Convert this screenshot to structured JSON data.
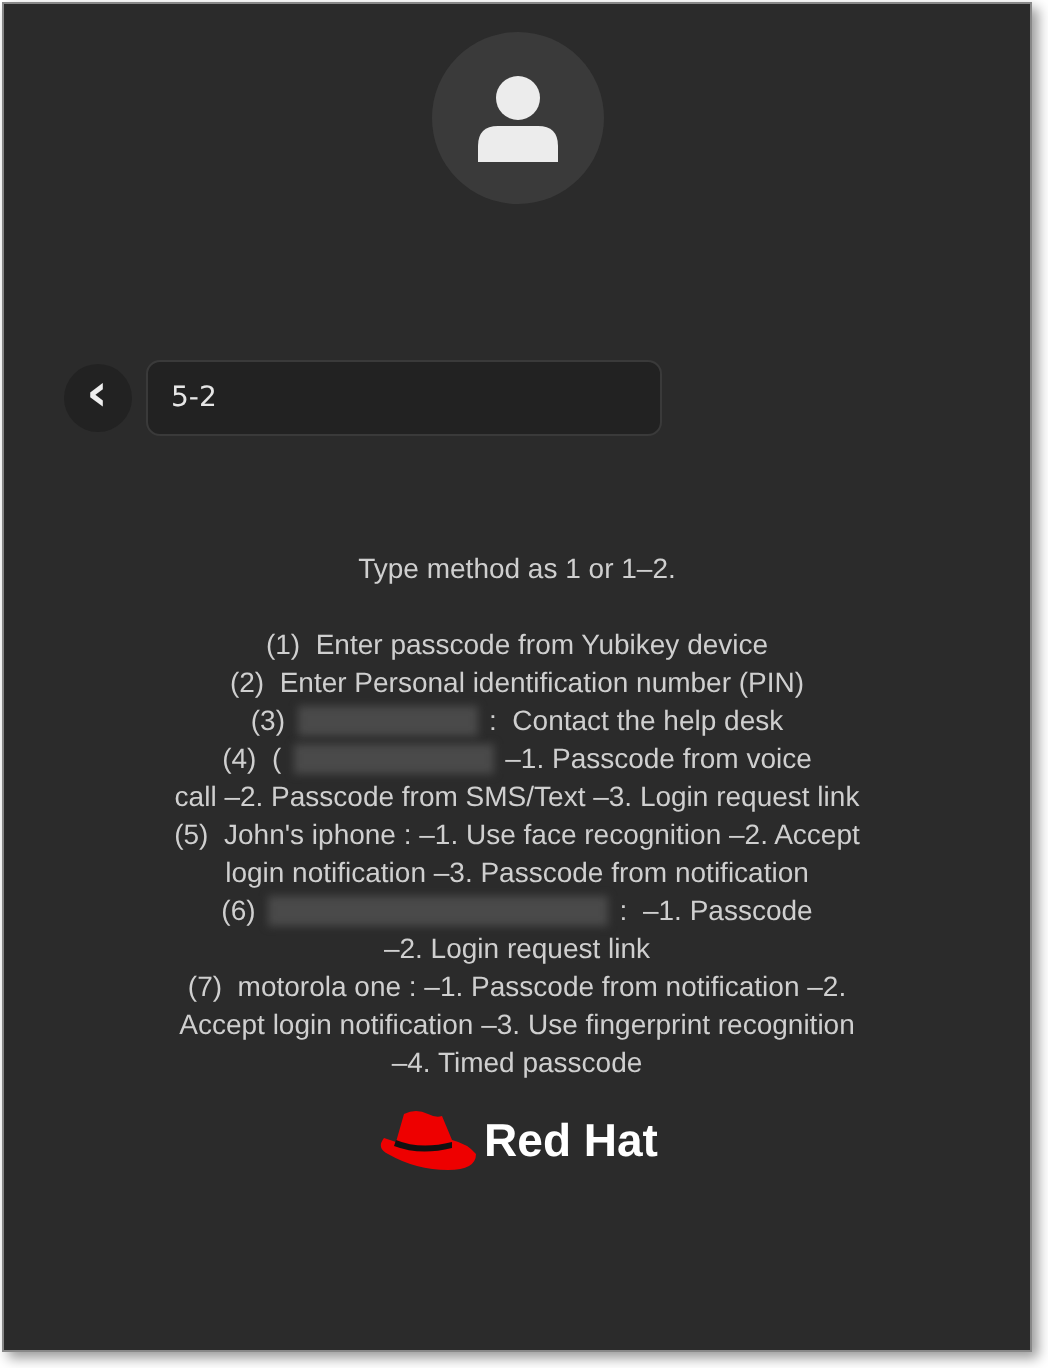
{
  "login": {
    "back_button": "‹",
    "passcode": "5-2",
    "instruction": "Type method as 1 or 1–2.",
    "options": [
      {
        "prefix": "(1)",
        "redacted": false,
        "text": "Enter passcode from Yubikey device"
      },
      {
        "prefix": "(2)",
        "redacted": false,
        "text": "Enter Personal identification number (PIN)"
      },
      {
        "prefix": "(3)",
        "redacted": true,
        "text": ":  Contact the help desk"
      },
      {
        "prefix": "(4)  (",
        "redacted": true,
        "text": "–1. Passcode from voice",
        "continuation": "call  –2. Passcode from SMS/Text  –3. Login request link"
      },
      {
        "prefix": "(5)",
        "redacted": false,
        "text": "John's iphone :  –1. Use face recognition  –2. Accept login notification  –3. Passcode from notification"
      },
      {
        "prefix": "(6)",
        "redacted": true,
        "text": ":  –1. Passcode",
        "continuation": "–2. Login request link"
      },
      {
        "prefix": "(7)",
        "redacted": false,
        "text": "motorola one :  –1. Passcode from notification  –2. Accept login notification  –3. Use fingerprint recognition  –4. Timed passcode"
      }
    ],
    "brand": "Red Hat"
  }
}
